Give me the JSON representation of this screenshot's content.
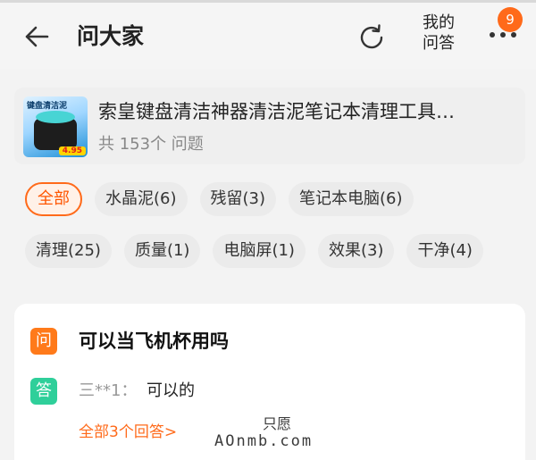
{
  "header": {
    "back_icon": "arrow-left-icon",
    "title": "问大家",
    "refresh_icon": "refresh-icon",
    "my_qa_line1": "我的",
    "my_qa_line2": "问答",
    "more_icon": "more-dots-icon",
    "badge_count": "9"
  },
  "product": {
    "thumb_caption": "键盘清洁泥",
    "thumb_price": "4.95",
    "name": "索皇键盘清洁神器清洁泥笔记本清理工具…",
    "question_count": "共 153个 问题"
  },
  "tags_row1": [
    "全部",
    "水晶泥(6)",
    "残留(3)",
    "笔记本电脑(6)"
  ],
  "tags_row2": [
    "清理(25)",
    "质量(1)",
    "电脑屏(1)",
    "效果(3)",
    "干净(4)"
  ],
  "qa": {
    "question_icon_label": "问",
    "question": "可以当飞机杯用吗",
    "answer_icon_label": "答",
    "answer_user": "三**1：",
    "answer_text": "可以的",
    "all_answers_link": "全部3个回答>"
  },
  "watermark": {
    "line1": "只愿",
    "line2": "AOnmb.com"
  },
  "colors": {
    "accent": "#ff6a1a",
    "answer_green": "#2fcf9a",
    "background": "#f3f3f3"
  }
}
